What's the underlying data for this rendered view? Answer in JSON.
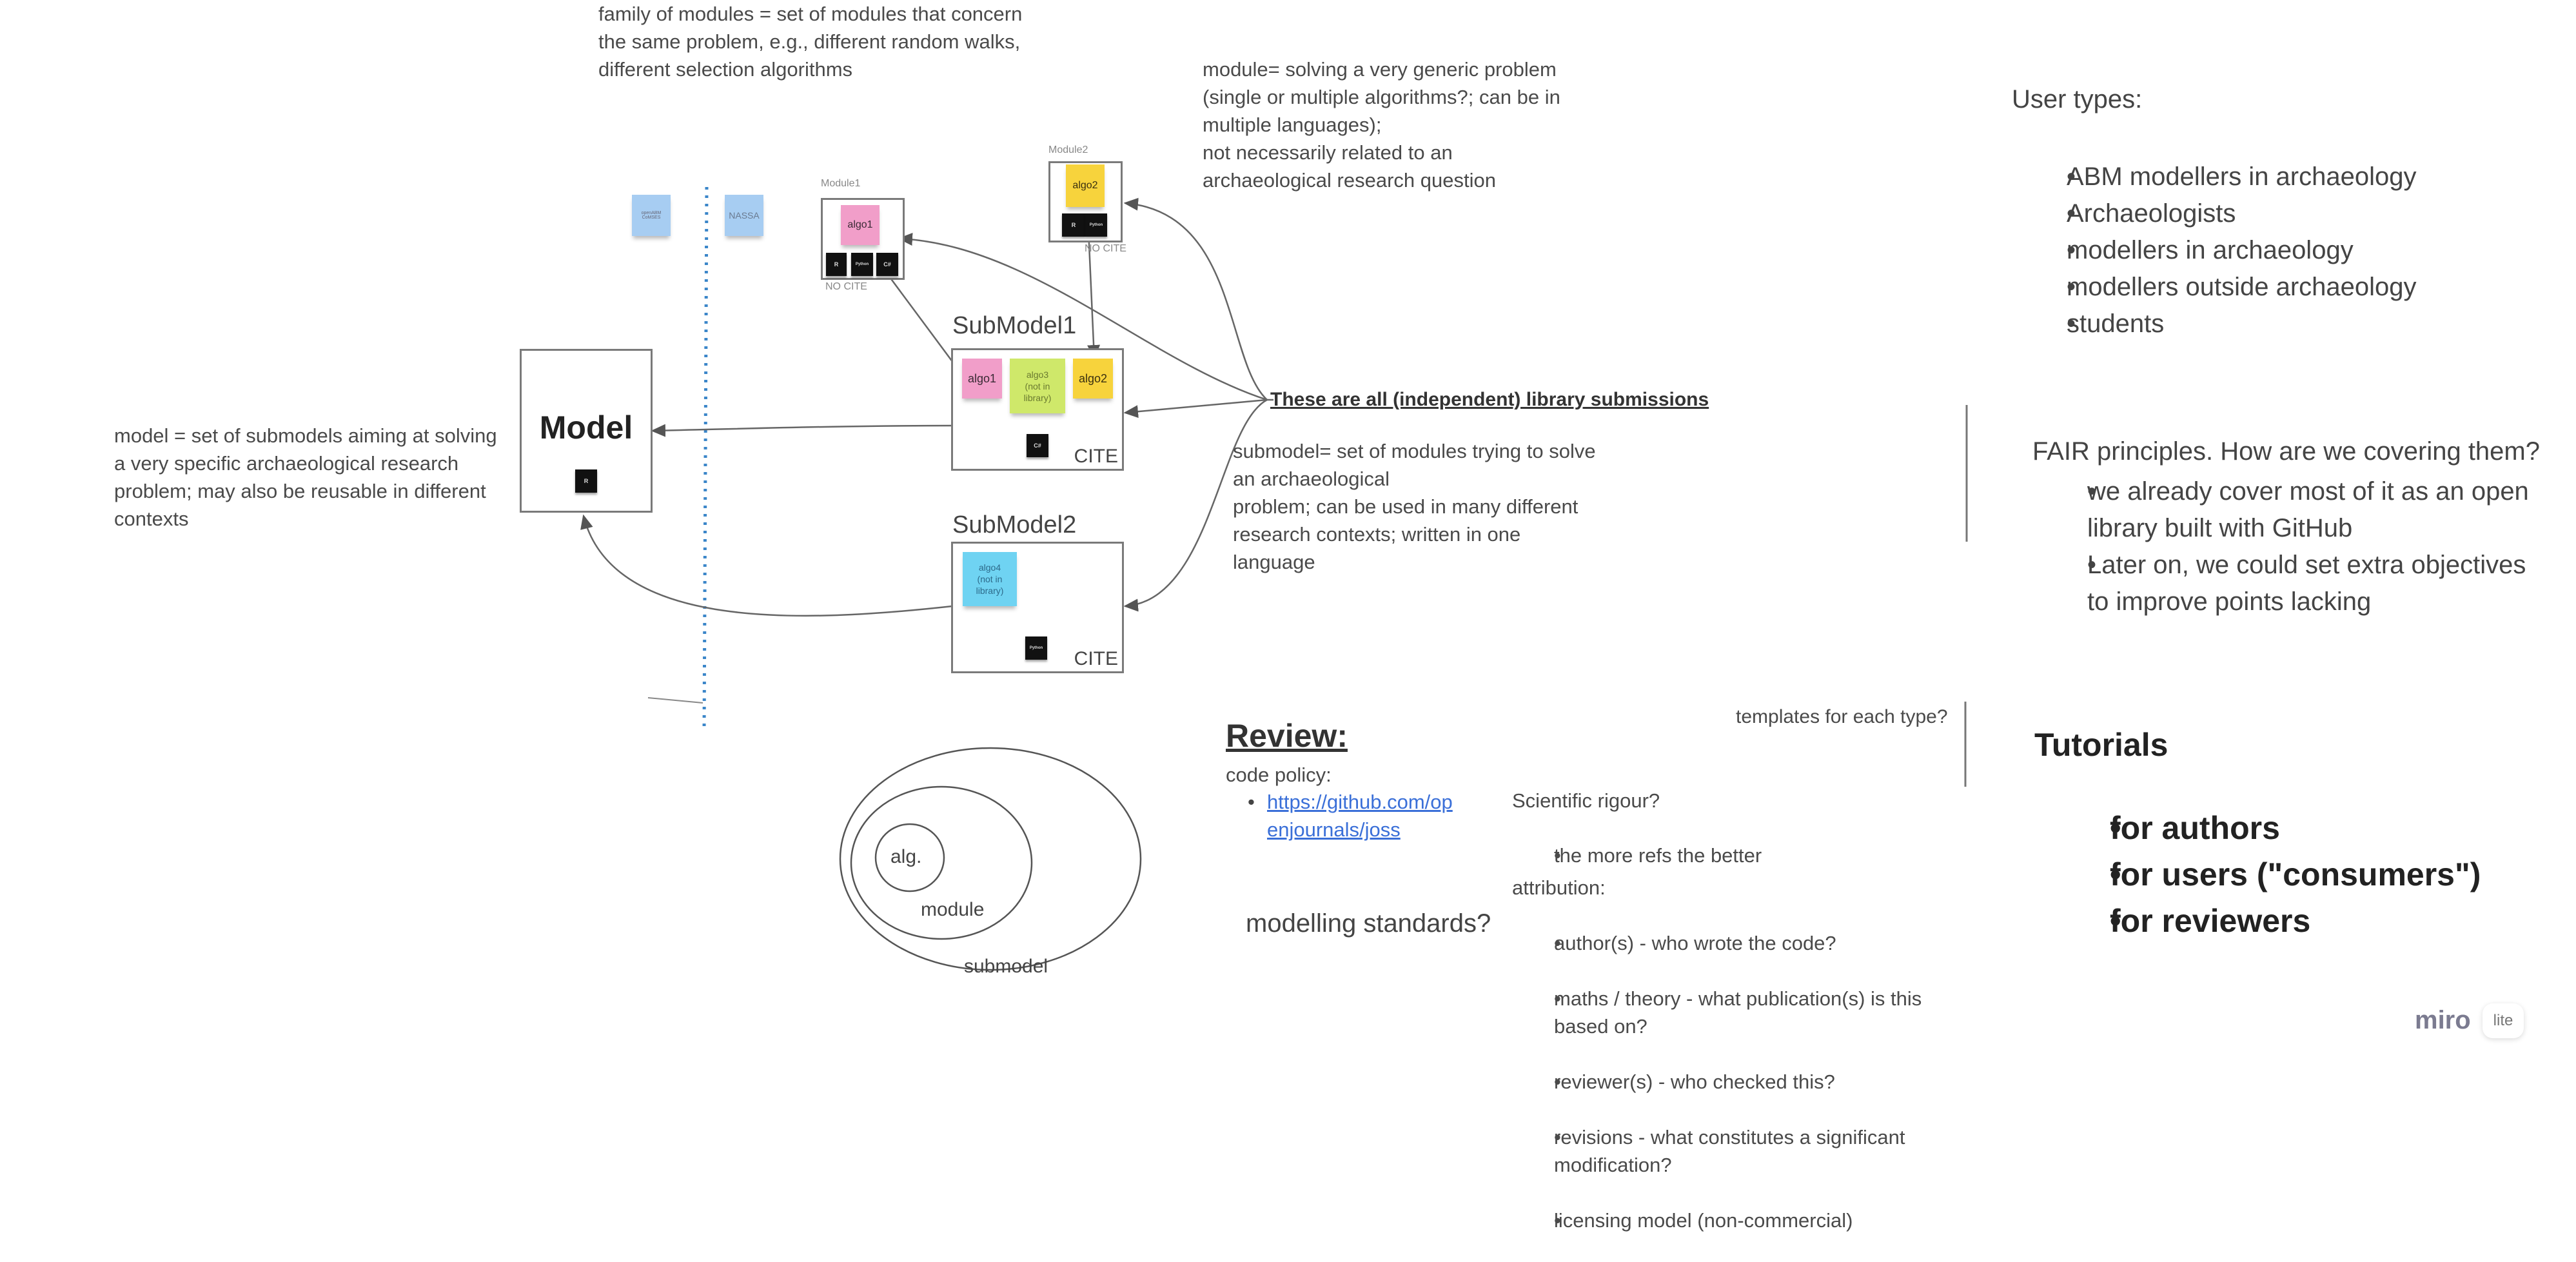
{
  "notes": {
    "family": "family of modules = set of modules that concern\nthe same problem, e.g., different random walks,\ndifferent selection algorithms",
    "module": "module= solving a very generic problem\n(single or multiple algorithms?; can be in\nmultiple languages);\nnot necessarily related to an\narchaeological research question",
    "model": "model = set of submodels aiming at solving\na very specific archaeological research\nproblem; may also be reusable in different\ncontexts",
    "submodel": "submodel= set of modules trying to solve\nan archaeological\nproblem; can be used in many different\nresearch contexts; written in one\nlanguage",
    "library_submissions": "These are all (independent) library submissions"
  },
  "stickies": {
    "openabm": "openABM\nCoMSES",
    "nassa": "NASSA"
  },
  "diagram": {
    "model": {
      "title": "Model",
      "tags": [
        "R"
      ]
    },
    "module1": {
      "title": "Module1",
      "sticky": "algo1",
      "tags": [
        "R",
        "Python",
        "C#"
      ],
      "status": "NO CITE"
    },
    "module2": {
      "title": "Module2",
      "sticky": "algo2",
      "tags": [
        "R",
        "Python"
      ],
      "status": "NO CITE"
    },
    "submodel1": {
      "title": "SubModel1",
      "stickies": [
        "algo1",
        "algo3\n(not in\nlibrary)",
        "algo2"
      ],
      "tags": [
        "C#"
      ],
      "status": "CITE"
    },
    "submodel2": {
      "title": "SubModel2",
      "stickies": [
        "algo4\n(not in\nlibrary)"
      ],
      "tags": [
        "Python"
      ],
      "status": "CITE"
    },
    "venn": {
      "inner": "alg.",
      "middle": "module",
      "outer": "submodel"
    }
  },
  "review": {
    "title": "Review:",
    "code_policy_label": "code policy:",
    "code_policy_link": "https://github.com/op\nenjournals/joss",
    "modelling_standards": "modelling standards?",
    "templates": "templates for each type?",
    "rigour_label": "Scientific rigour?",
    "rigour_items": [
      "the more refs the better"
    ],
    "attribution_label": "attribution:",
    "attribution_items": [
      "author(s) - who wrote the code?",
      "maths / theory - what publication(s) is this\nbased on?",
      "reviewer(s) - who checked this?",
      "revisions - what constitutes a significant\nmodification?",
      "licensing model (non-commercial)"
    ]
  },
  "user_types": {
    "title": "User types:",
    "items": [
      "ABM modellers in archaeology",
      "Archaeologists",
      "modellers in archaeology",
      "modellers outside archaeology",
      "students"
    ]
  },
  "fair": {
    "title": "FAIR principles. How are we covering them?",
    "items": [
      "we already cover most of it as an open\nlibrary built with GitHub",
      "Later on, we could set extra objectives\nto improve points lacking"
    ]
  },
  "tutorials": {
    "title": "Tutorials",
    "items": [
      "for authors",
      "for users (\"consumers\")",
      "for reviewers"
    ]
  },
  "branding": {
    "logo": "miro",
    "badge": "lite"
  },
  "colors": {
    "pink": "#f19ec9",
    "yellow": "#f7d33c",
    "lime": "#cfe86a",
    "cyan": "#6fd3f2",
    "light_blue": "#a7cdf2",
    "divider_blue": "#3b86c9"
  }
}
